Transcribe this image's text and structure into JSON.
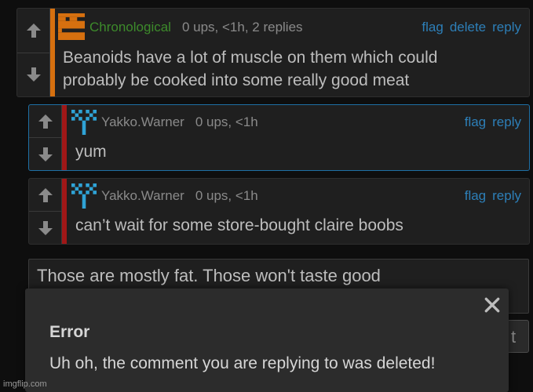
{
  "comments": [
    {
      "username": "Chronological",
      "stats": "0 ups, <1h, 2 replies",
      "actions": [
        "flag",
        "delete",
        "reply"
      ],
      "text_lines": [
        "Beanoids have a lot of muscle on them which could",
        "probably be cooked into some really good meat"
      ],
      "stripe_color": "#d6700f",
      "avatar": "orange-pixel-avatar"
    },
    {
      "username": "Yakko.Warner",
      "stats": "0 ups, <1h",
      "actions": [
        "flag",
        "reply"
      ],
      "text_lines": [
        "yum"
      ],
      "stripe_color": "#a01717",
      "avatar": "blue-pixel-avatar"
    },
    {
      "username": "Yakko.Warner",
      "stats": "0 ups, <1h",
      "actions": [
        "flag",
        "reply"
      ],
      "text_lines": [
        "can’t wait for some store-bought claire boobs"
      ],
      "stripe_color": "#a01717",
      "avatar": "blue-pixel-avatar"
    }
  ],
  "reply": {
    "text": "Those are mostly fat. Those won't taste good",
    "submit_partial": "t"
  },
  "modal": {
    "title": "Error",
    "message": "Uh oh, the comment you are replying to was deleted!",
    "close_icon": "close-icon"
  },
  "watermark": "imgflip.com",
  "colors": {
    "link": "#2d7fb8",
    "green_user": "#3d8b2b",
    "orange_stripe": "#d6700f",
    "red_stripe": "#a01717",
    "highlight_border": "#1e6fa5"
  }
}
